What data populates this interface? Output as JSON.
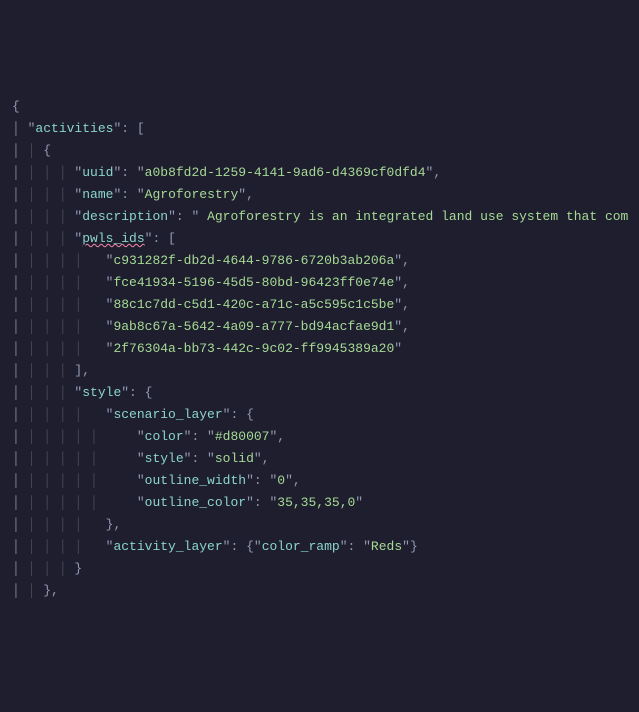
{
  "code": {
    "keys": {
      "activities": "activities",
      "uuid": "uuid",
      "name": "name",
      "description": "description",
      "pwls_ids": "pwls_ids",
      "style": "style",
      "scenario_layer": "scenario_layer",
      "color": "color",
      "style2": "style",
      "outline_width": "outline_width",
      "outline_color": "outline_color",
      "activity_layer": "activity_layer",
      "color_ramp": "color_ramp"
    },
    "values": {
      "uuid": "a0b8fd2d-1259-4141-9ad6-d4369cf0dfd4",
      "name": "Agroforestry",
      "description": " Agroforestry is an integrated land use system that com",
      "pwls_id_0": "c931282f-db2d-4644-9786-6720b3ab206a",
      "pwls_id_1": "fce41934-5196-45d5-80bd-96423ff0e74e",
      "pwls_id_2": "88c1c7dd-c5d1-420c-a71c-a5c595c1c5be",
      "pwls_id_3": "9ab8c67a-5642-4a09-a777-bd94acfae9d1",
      "pwls_id_4": "2f76304a-bb73-442c-9c02-ff9945389a20",
      "color": "#d80007",
      "style": "solid",
      "outline_width": "0",
      "outline_color": "35,35,35,0",
      "color_ramp": "Reds"
    }
  }
}
